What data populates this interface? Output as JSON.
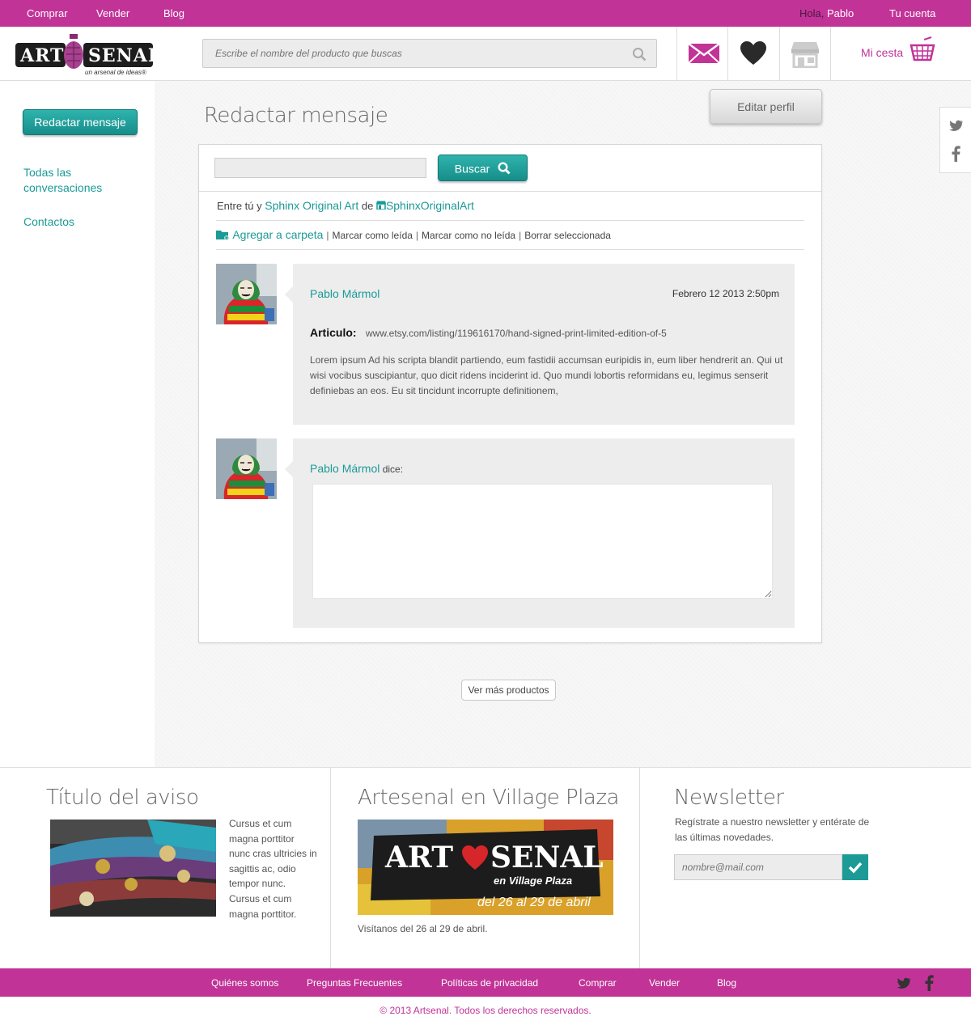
{
  "topbar": {
    "nav": [
      "Comprar",
      "Vender",
      "Blog"
    ],
    "greeting": "Hola,",
    "user": "Pablo",
    "account": "Tu cuenta"
  },
  "header": {
    "logo_left": "ART",
    "logo_right": "SENAL",
    "logo_tagline": "un arsenal de ideas®",
    "search_placeholder": "Escribe el nombre del producto que buscas",
    "cart_label": "Mi cesta"
  },
  "colors": {
    "brand": "#c13397",
    "accent": "#1b9a96"
  },
  "sidebar": {
    "compose_label": "Redactar mensaje",
    "links": [
      "Todas las conversaciones",
      "Contactos"
    ]
  },
  "main": {
    "title": "Redactar mensaje",
    "edit_profile": "Editar perfil",
    "search_button": "Buscar",
    "between_prefix": "Entre tú y",
    "between_name": "Sphinx Original Art",
    "between_de": "de",
    "between_shop": "SphinxOriginalArt",
    "actions": [
      "Agregar a carpeta",
      "Marcar como leída",
      "Marcar como no leída",
      "Borrar seleccionada"
    ],
    "message": {
      "author": "Pablo Mármol",
      "date": "Febrero 12 2013 2:50pm",
      "articulo_label": "Articulo:",
      "articulo_url": "www.etsy.com/listing/119616170/hand-signed-print-limited-edition-of-5",
      "body": "Lorem ipsum Ad his scripta blandit partiendo, eum fastidii accumsan euripidis in, eum liber hendrerit an. Qui ut wisi vocibus suscipiantur, quo dicit ridens inciderint id. Quo mundi lobortis reformidans eu, legimus senserit definiebas an eos. Eu sit tincidunt incorrupte definitionem,"
    },
    "reply": {
      "author": "Pablo Mármol",
      "says": "dice:"
    },
    "more_button": "Ver más productos"
  },
  "footer": {
    "col1": {
      "title": "Título del aviso",
      "text": "Cursus et cum magna porttitor nunc cras ultricies in sagittis ac, odio tempor nunc. Cursus et cum magna porttitor."
    },
    "col2": {
      "title": "Artesenal en Village Plaza",
      "banner_left": "ART",
      "banner_right": "SENAL",
      "banner_sub": "en Village Plaza",
      "banner_dates": "del 26 al 29 de abril",
      "text": "Visítanos del 26 al 29 de abril."
    },
    "col3": {
      "title": "Newsletter",
      "text": "Regístrate a nuestro newsletter y entérate de las últimas novedades.",
      "placeholder": "nombre@mail.com"
    }
  },
  "bottombar": {
    "links": [
      "Quiénes somos",
      "Preguntas Frecuentes",
      "Políticas de privacidad",
      "Comprar",
      "Vender",
      "Blog"
    ],
    "copyright": "© 2013 Artsenal. Todos los derechos reservados."
  }
}
